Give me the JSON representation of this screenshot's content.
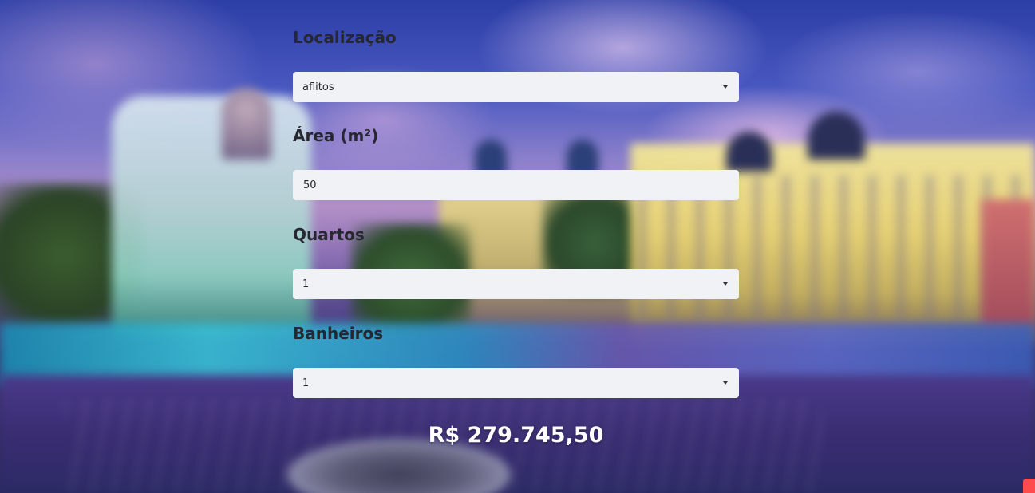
{
  "form": {
    "localizacao": {
      "label": "Localização",
      "value": "aflitos",
      "icon": "chevron-down-icon"
    },
    "area": {
      "label": "Área (m²)",
      "value": "50"
    },
    "quartos": {
      "label": "Quartos",
      "value": "1",
      "icon": "chevron-down-icon"
    },
    "banheiros": {
      "label": "Banheiros",
      "value": "1",
      "icon": "chevron-down-icon"
    }
  },
  "result": {
    "price": "R$ 279.745,50"
  },
  "colors": {
    "label_text": "#262730",
    "field_bg": "#f0f2f6",
    "price_text": "#ffffff",
    "accent": "#ff4b4b"
  }
}
